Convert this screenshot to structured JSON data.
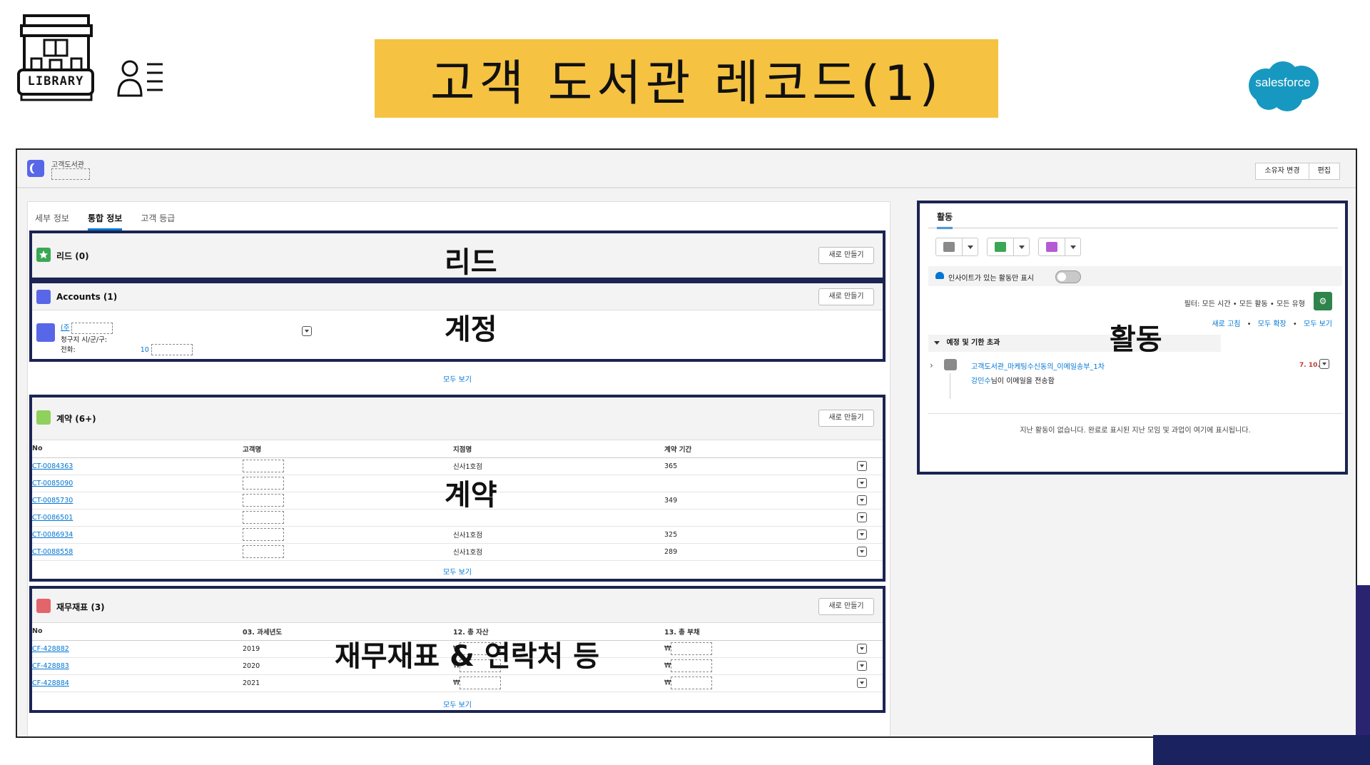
{
  "slide": {
    "title": "고객 도서관 레코드(1)",
    "logo_text": "LIBRARY",
    "brand_text": "salesforce"
  },
  "record": {
    "object_label": "고객도서관",
    "buttons": [
      "소유자 변경",
      "편집"
    ]
  },
  "left_tabs": [
    "세부 정보",
    "통합 정보",
    "고객 등급"
  ],
  "active_tab": "통합 정보",
  "new_button_label": "새로 만들기",
  "view_all_label": "모두 보기",
  "leads": {
    "title": "리드 (0)",
    "overlay": "리드"
  },
  "accounts": {
    "title": "Accounts (1)",
    "overlay": "계정",
    "item_link_prefix": "(주",
    "field_billing": "청구지 시/군/구:",
    "field_phone": "전화:",
    "phone_prefix": "10"
  },
  "contracts": {
    "title": "계약 (6+)",
    "overlay": "계약",
    "columns": [
      "No",
      "고객명",
      "지점명",
      "계약 기간"
    ],
    "rows": [
      {
        "no": "CT-0084363",
        "branch": "신사1호점",
        "period": "365"
      },
      {
        "no": "CT-0085090",
        "branch": "",
        "period": ""
      },
      {
        "no": "CT-0085730",
        "branch": "",
        "period": "349"
      },
      {
        "no": "CT-0086501",
        "branch": "",
        "period": ""
      },
      {
        "no": "CT-0086934",
        "branch": "신사1호점",
        "period": "325"
      },
      {
        "no": "CT-0088558",
        "branch": "신사1호점",
        "period": "289"
      }
    ]
  },
  "financials": {
    "title": "재무재표 (3)",
    "overlay": "재무재표 & 연락처 등",
    "columns": [
      "No",
      "03. 과세년도",
      "12. 총 자산",
      "13. 총 부채"
    ],
    "rows": [
      {
        "no": "CF-428882",
        "year": "2019",
        "asset": "₩",
        "debt": "₩"
      },
      {
        "no": "CF-428883",
        "year": "2020",
        "asset": "₩",
        "debt": "₩"
      },
      {
        "no": "CF-428884",
        "year": "2021",
        "asset": "₩",
        "debt": "₩"
      }
    ]
  },
  "activity": {
    "tab": "활동",
    "overlay": "활동",
    "insight_label": "인사이트가 있는 활동만 표시",
    "filter_text": "필터: 모든 시간 • 모든 활동 • 모든 유형",
    "links": [
      "새로 고침",
      "모두 확장",
      "모두 보기"
    ],
    "upcoming_label": "예정 및 기한 초과",
    "email_subject": "고객도서관_마케팅수신동의_이메일송부_1차",
    "email_date": "7. 10.",
    "email_sender": "강민수",
    "email_action": "님이 이메일을 전송함",
    "empty_text": "지난 활동이 없습니다. 완료로 표시된 지난 모임 및 과업이 여기에 표시됩니다."
  },
  "colors": {
    "banner": "#f5c242",
    "salesforce": "#1798c1",
    "highlight_border": "#1b2452",
    "link": "#0176d3"
  }
}
